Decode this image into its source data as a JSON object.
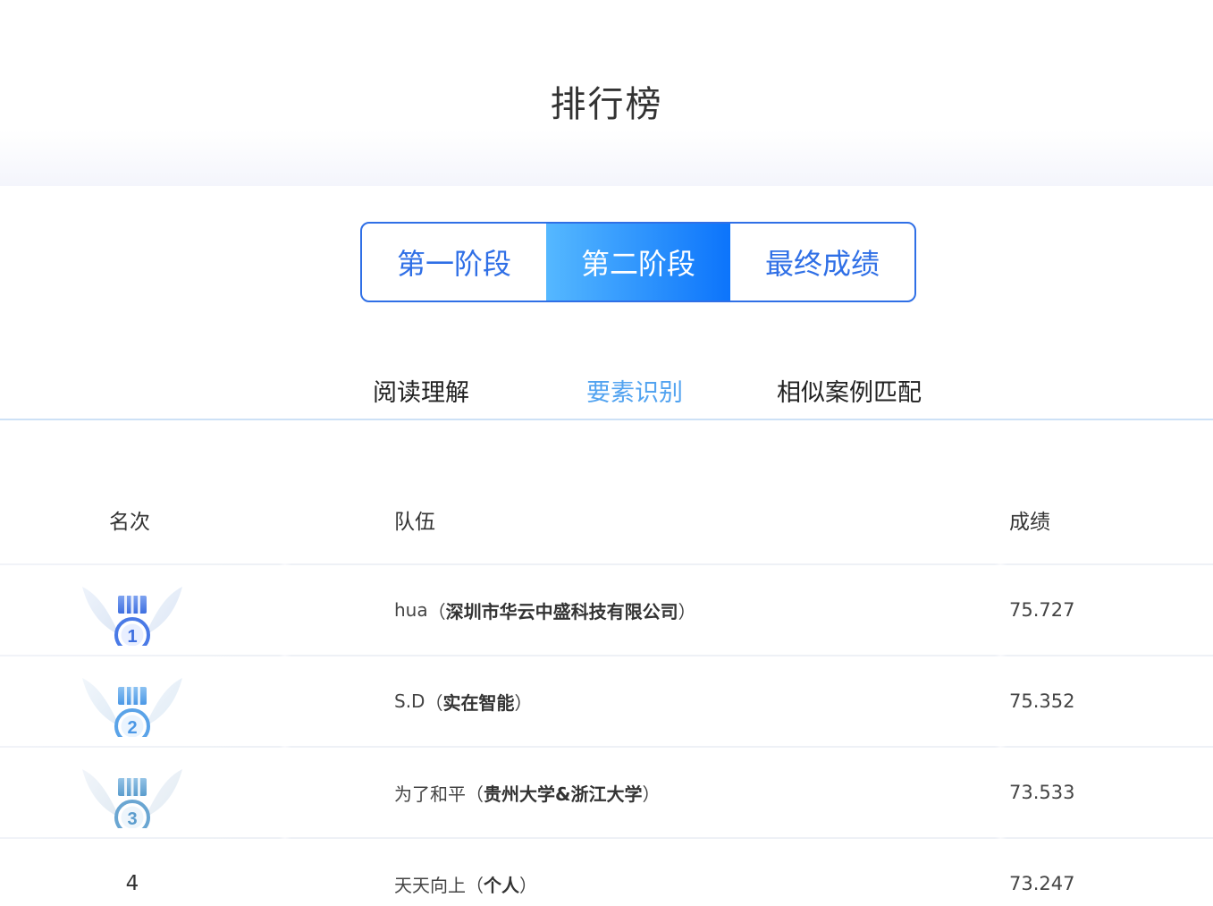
{
  "page": {
    "title": "排行榜"
  },
  "stage_tabs": [
    {
      "label": "第一阶段",
      "active": false
    },
    {
      "label": "第二阶段",
      "active": true
    },
    {
      "label": "最终成绩",
      "active": false
    }
  ],
  "sub_tabs": [
    {
      "label": "阅读理解",
      "active": false
    },
    {
      "label": "要素识别",
      "active": true
    },
    {
      "label": "相似案例匹配",
      "active": false
    }
  ],
  "table": {
    "headers": {
      "rank": "名次",
      "team": "队伍",
      "score": "成绩"
    },
    "rows": [
      {
        "rank": "1",
        "medal": "medal-1-icon",
        "team": "hua",
        "paren_open": "（",
        "org": "深圳市华云中盛科技有限公司",
        "paren_close": "）",
        "score": "75.727"
      },
      {
        "rank": "2",
        "medal": "medal-2-icon",
        "team": "S.D",
        "paren_open": "（",
        "org": "实在智能",
        "paren_close": "）",
        "score": "75.352"
      },
      {
        "rank": "3",
        "medal": "medal-3-icon",
        "team": "为了和平",
        "paren_open": "（",
        "org": "贵州大学&浙江大学",
        "paren_close": "）",
        "score": "73.533"
      },
      {
        "rank": "4",
        "medal": null,
        "team": "天天向上",
        "paren_open": "（",
        "org": "个人",
        "paren_close": "）",
        "score": "73.247"
      }
    ]
  },
  "colors": {
    "accent": "#2f6fe6",
    "active_gradient_start": "#55b8ff",
    "active_gradient_end": "#0c74fb",
    "subtab_active": "#52a3f0"
  }
}
